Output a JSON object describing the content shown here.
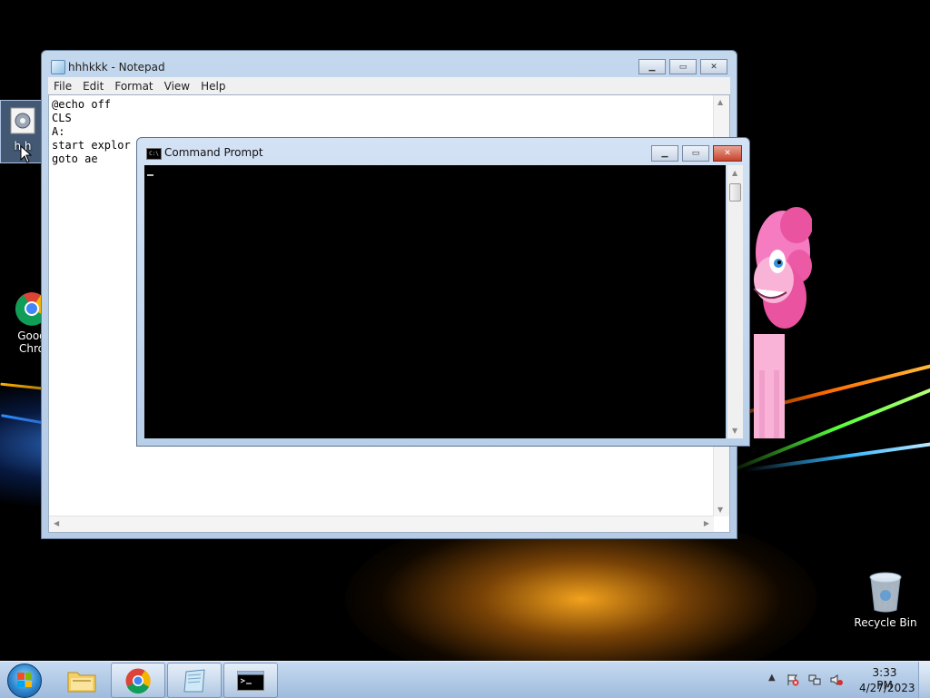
{
  "notepad": {
    "title": "hhhkkk - Notepad",
    "menu": [
      "File",
      "Edit",
      "Format",
      "View",
      "Help"
    ],
    "content": "@echo off\nCLS\nA:\nstart explor\ngoto ae"
  },
  "cmd": {
    "title": "Command Prompt"
  },
  "desktop": {
    "selected_icon_label": "h h",
    "chrome_label_line1": "Goog",
    "chrome_label_line2": "Chro",
    "recycle_bin_label": "Recycle Bin"
  },
  "taskbar": {
    "pinned": [
      "windows-explorer",
      "google-chrome",
      "notepad",
      "command-prompt"
    ],
    "time": "3:33 PM",
    "date": "4/27/2023"
  },
  "colors": {
    "taskbar": "#b4cbe8",
    "console_bg": "#000000",
    "close_button": "#c6432c"
  }
}
